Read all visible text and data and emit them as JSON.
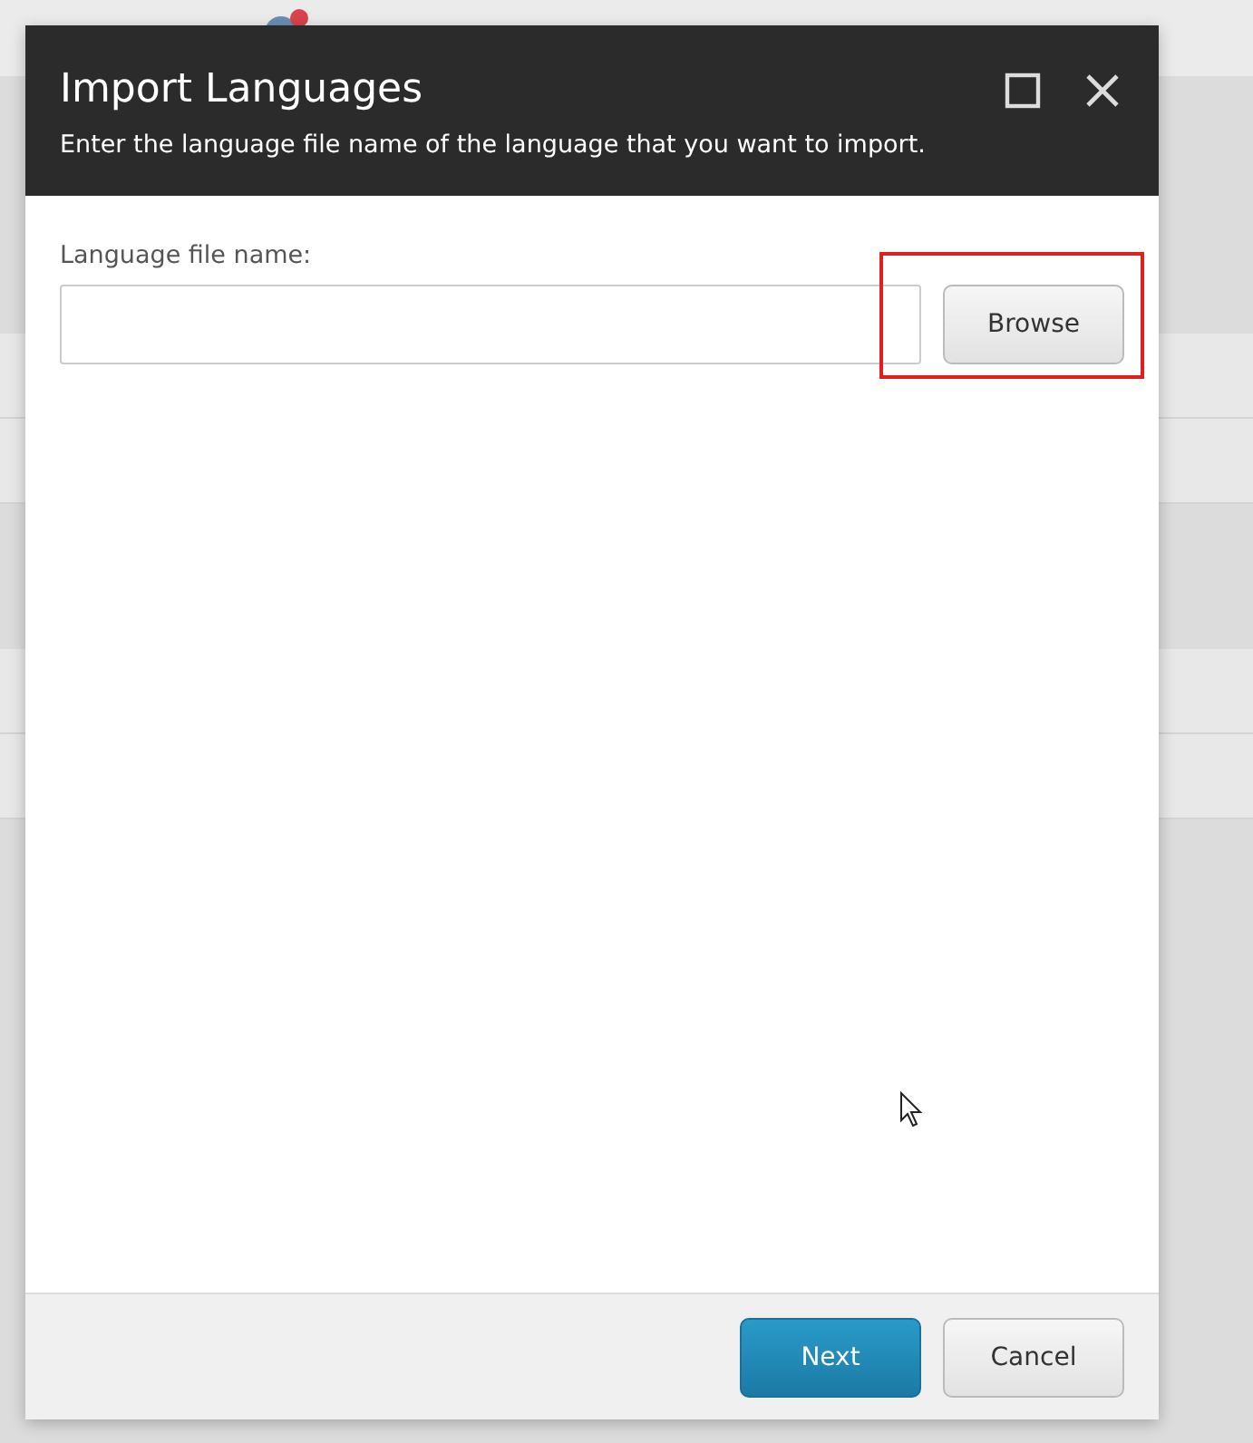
{
  "dialog": {
    "title": "Import Languages",
    "subtitle": "Enter the language file name of the language that you want to import.",
    "field": {
      "label": "Language file name:"
    },
    "browse_button": {
      "label": "Browse",
      "highlighted": true
    },
    "buttons": [
      {
        "label": "Next",
        "kind": "primary"
      },
      {
        "label": "Cancel",
        "kind": "secondary"
      }
    ]
  }
}
